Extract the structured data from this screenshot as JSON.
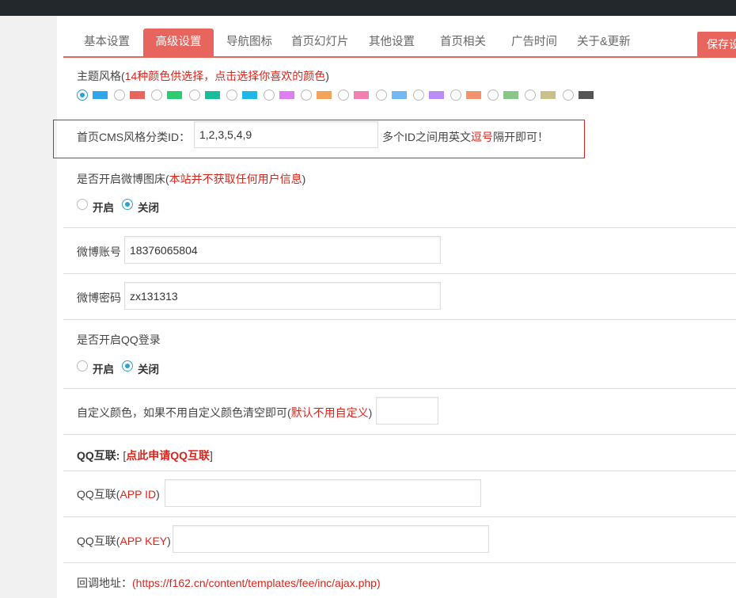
{
  "tabs": [
    {
      "label": "基本设置",
      "active": false
    },
    {
      "label": "高级设置",
      "active": true
    },
    {
      "label": "导航图标",
      "active": false
    },
    {
      "label": "首页幻灯片",
      "active": false
    },
    {
      "label": "其他设置",
      "active": false
    },
    {
      "label": "首页相关",
      "active": false
    },
    {
      "label": "广告时间",
      "active": false
    },
    {
      "label": "关于&更新",
      "active": false
    }
  ],
  "save_label": "保存设",
  "theme": {
    "label": "主题风格(",
    "hint": "14种颜色供选择，点击选择你喜欢的颜色",
    "close": ")",
    "colors": [
      "#2fa7e8",
      "#e8655e",
      "#2ecc71",
      "#1abc9c",
      "#1fb6e8",
      "#dd7ff2",
      "#f5a25d",
      "#f27fb0",
      "#72b8f2",
      "#b98cf5",
      "#f2926f",
      "#88c68a",
      "#c9c08a",
      "#555555"
    ],
    "selected_index": 0
  },
  "cms": {
    "label": "首页CMS风格分类ID：",
    "value": "1,2,3,5,4,9",
    "note_pre": "多个ID之间用英文",
    "note_red": "逗号",
    "note_post": "隔开即可！"
  },
  "weibo_bed": {
    "label": "是否开启微博图床(",
    "hint": "本站并不获取任何用户信息",
    "close": ")",
    "on_label": "开启",
    "off_label": "关闭",
    "selected": "off"
  },
  "weibo_account": {
    "label": "微博账号",
    "value": "18376065804"
  },
  "weibo_password": {
    "label": "微博密码",
    "value": "zx131313"
  },
  "qq_login": {
    "label": "是否开启QQ登录",
    "on_label": "开启",
    "off_label": "关闭",
    "selected": "off"
  },
  "custom_color": {
    "label": "自定义颜色，如果不用自定义颜色清空即可(",
    "hint": "默认不用自定义",
    "close": ")",
    "value": ""
  },
  "qq_connect": {
    "title": "QQ互联:",
    "bracket_open": "[",
    "link": "点此申请QQ互联",
    "bracket_close": "]"
  },
  "qq_app_id": {
    "label_pre": "QQ互联(",
    "label_red": "APP ID",
    "label_post": ")",
    "value": ""
  },
  "qq_app_key": {
    "label_pre": "QQ互联(",
    "label_red": "APP KEY",
    "label_post": ")",
    "value": ""
  },
  "callback": {
    "label": "回调地址：",
    "url": "(https://f162.cn/content/templates/fee/inc/ajax.php)"
  }
}
